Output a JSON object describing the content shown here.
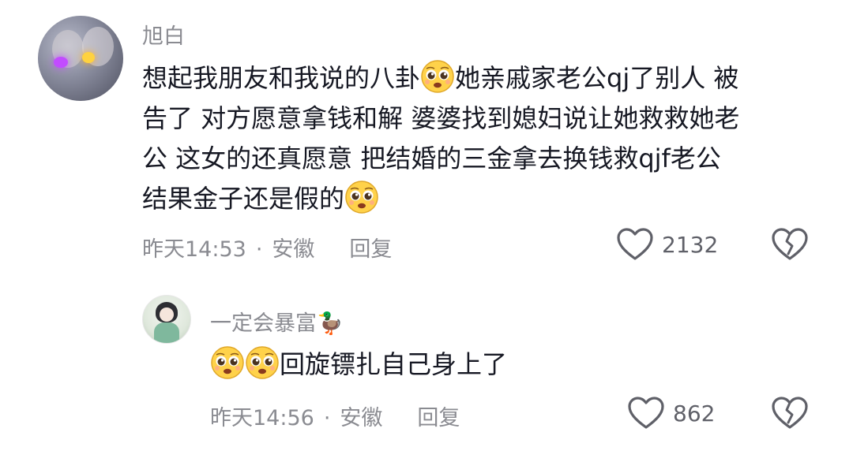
{
  "comments": [
    {
      "username": "旭白",
      "text_segments": [
        "想起我朋友和我说的八卦",
        "她亲戚家老公qj了别人 被",
        "告了 对方愿意拿钱和解 婆婆找到媳妇说让她救救她老",
        "公 这女的还真愿意 把结婚的三金拿去换钱救qjf老公",
        "结果金子还是假的"
      ],
      "emoji_icon": "pleading-face-emoji",
      "time": "昨天14:53",
      "separator": "·",
      "location": "安徽",
      "reply_label": "回复",
      "like_count": "2132"
    },
    {
      "username": "一定会暴富🦆",
      "text": "回旋镖扎自己身上了",
      "emoji_icon": "pleading-face-emoji",
      "time": "昨天14:56",
      "separator": "·",
      "location": "安徽",
      "reply_label": "回复",
      "like_count": "862"
    }
  ],
  "colors": {
    "text": "#161823",
    "secondary": "#8a8b91",
    "icon": "#5f6068",
    "emoji_face": "#ffd24a"
  }
}
